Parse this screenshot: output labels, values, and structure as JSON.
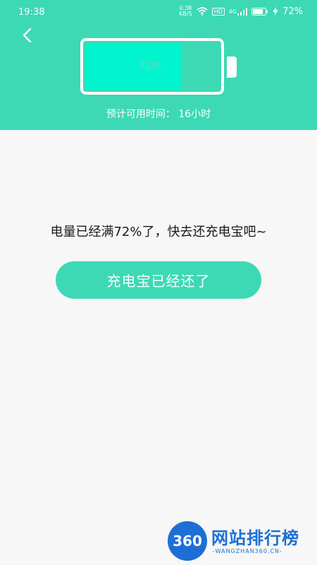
{
  "status_bar": {
    "time": "19:38",
    "net_speed_value": "0.38",
    "net_speed_unit": "KB/S",
    "hd_label": "HD",
    "signal_label": "4G",
    "battery_percent": "72%"
  },
  "battery": {
    "level_percent": 72,
    "label": "72%"
  },
  "estimate_text": "预计可用时间：  16小时",
  "message": "电量已经满72%了，快去还充电宝吧~",
  "returned_button_label": "充电宝已经还了",
  "watermark": {
    "badge": "360",
    "title": "网站排行榜",
    "subtitle": "-WANGZHAN360.CN-"
  },
  "colors": {
    "accent": "#3dd8b4",
    "fill": "#00f5cf",
    "background": "#f7f7f7"
  },
  "icons": {
    "back": "chevron-left-icon",
    "wifi": "wifi-icon",
    "signal": "signal-icon",
    "battery": "battery-icon",
    "charging": "lightning-icon"
  }
}
